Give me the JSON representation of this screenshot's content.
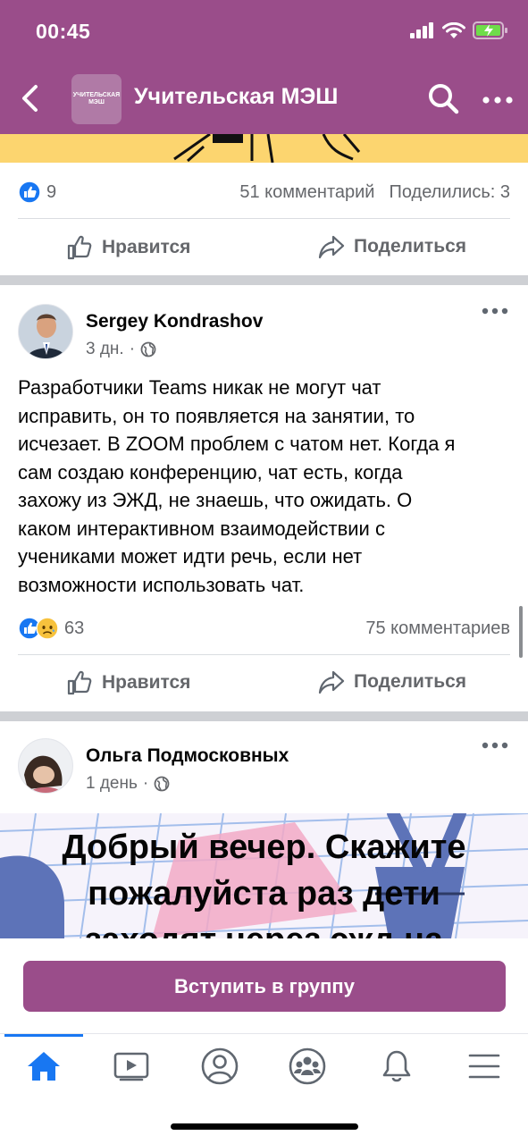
{
  "status": {
    "time": "00:45"
  },
  "header": {
    "title": "Учительская МЭШ",
    "avatar_text": "УЧИТЕЛЬСКАЯ МЭШ"
  },
  "prev_post": {
    "like_count": "9",
    "comments": "51 комментарий",
    "shares": "Поделились: 3",
    "like_label": "Нравится",
    "share_label": "Поделиться"
  },
  "post1": {
    "author": "Sergey Kondrashov",
    "time": "3 дн.",
    "text_lines": [
      "Разработчики Teams никак не могут чат",
      "исправить, он то появляется на занятии, то",
      "исчезает. В ZOOM проблем с чатом нет. Когда я",
      "сам создаю конференцию, чат есть, когда",
      "захожу из ЭЖД, не знаешь, что ожидать. О",
      "каком интерактивном взаимодействии с",
      "учениками может идти речь, если нет",
      "возможности использовать чат."
    ],
    "reaction_count": "63",
    "comments": "75 комментариев",
    "like_label": "Нравится",
    "share_label": "Поделиться"
  },
  "post2": {
    "author": "Ольга Подмосковных",
    "time": "1 день",
    "image_text_lines": [
      "Добрый вечер. Скажите",
      "пожалуйста раз дети",
      "заходят через эжд на"
    ]
  },
  "join_button": "Вступить в группу",
  "tabs": [
    {
      "icon": "home-icon",
      "active": true
    },
    {
      "icon": "video-icon",
      "active": false
    },
    {
      "icon": "profile-icon",
      "active": false
    },
    {
      "icon": "groups-icon",
      "active": false
    },
    {
      "icon": "bell-icon",
      "active": false
    },
    {
      "icon": "menu-icon",
      "active": false
    }
  ],
  "colors": {
    "brand": "#9a4d8a",
    "like_blue": "#1877f2",
    "secondary_text": "#65676b"
  }
}
